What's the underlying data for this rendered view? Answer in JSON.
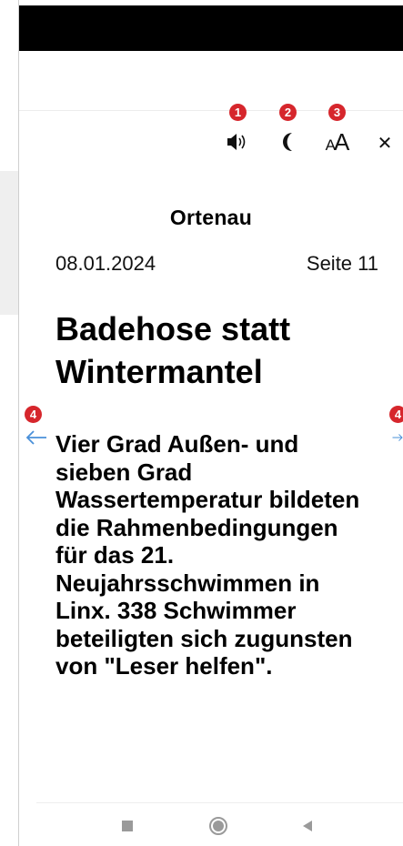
{
  "toolbar": {
    "badges": [
      "1",
      "2",
      "3",
      "4"
    ],
    "icons": {
      "audio": "speaker-icon",
      "night_mode": "moon-icon",
      "font_size": "font-size-icon",
      "close": "close-icon",
      "prev": "arrow-left-icon",
      "next": "arrow-right-icon"
    },
    "font_size_label": "AA",
    "close_label": "✕"
  },
  "article": {
    "section": "Ortenau",
    "date": "08.01.2024",
    "page": "Seite 11",
    "headline": "Badehose statt Wintermantel",
    "lead": "Vier Grad Außen- und sieben Grad Wassertemperatur bildeten die Rahmenbedingungen für das 21. Neujahrsschwimmen in Linx. 338 Schwimmer beteiligten sich zugunsten von \"Leser helfen\"."
  },
  "colors": {
    "badge": "#d6262c",
    "arrow": "#4a90d9",
    "nav": "#9a9a9a"
  },
  "system_nav": {
    "icons": [
      "square-icon",
      "circle-icon",
      "back-triangle-icon"
    ]
  }
}
